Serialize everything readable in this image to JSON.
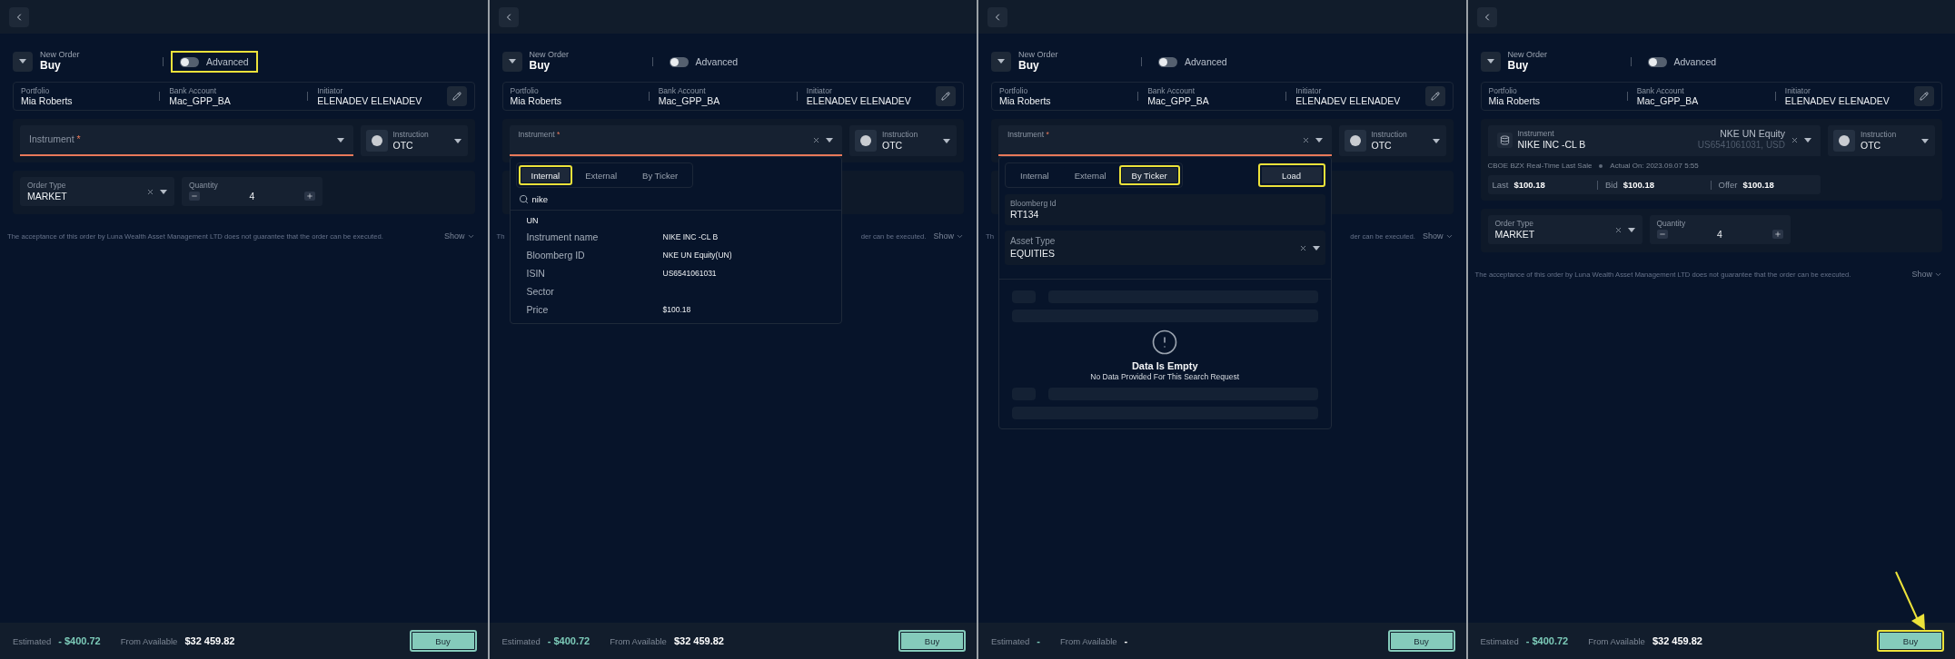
{
  "panels": [
    {
      "header": {
        "caption": "New Order",
        "side": "Buy",
        "advanced": {
          "label": "Advanced",
          "on": false,
          "highlighted": true
        }
      },
      "info": [
        {
          "label": "Portfolio",
          "value": "Mia Roberts"
        },
        {
          "label": "Bank Account",
          "value": "Mac_GPP_BA"
        },
        {
          "label": "Initiator",
          "value": "ELENADEV ELENADEV"
        }
      ],
      "instrument": {
        "kind": "empty",
        "label": "Instrument",
        "required_mark": "*",
        "error": true
      },
      "instruction": {
        "label": "Instruction",
        "value": "OTC"
      },
      "order": {
        "order_type": {
          "label": "Order Type",
          "value": "MARKET"
        },
        "quantity": {
          "label": "Quantity",
          "value": "4"
        }
      },
      "disclaimer": {
        "parts": [
          "The acceptance of this order by Luna Wealth Asset Management LTD does not guarantee that the order can be executed."
        ]
      },
      "show_toggle": "Show",
      "footer": {
        "estimated_label": "Estimated",
        "estimated_value": "- $400.72",
        "available_label": "From Available",
        "available_value": "$32 459.82",
        "buy_button": {
          "label": "Buy",
          "highlighted": false,
          "pointed": false
        }
      }
    },
    {
      "header": {
        "caption": "New Order",
        "side": "Buy",
        "advanced": {
          "label": "Advanced",
          "on": false,
          "highlighted": false
        }
      },
      "info": [
        {
          "label": "Portfolio",
          "value": "Mia Roberts"
        },
        {
          "label": "Bank Account",
          "value": "Mac_GPP_BA"
        },
        {
          "label": "Initiator",
          "value": "ELENADEV ELENADEV"
        }
      ],
      "instrument": {
        "kind": "focused",
        "label": "Instrument",
        "required_mark": "*",
        "error": true
      },
      "instruction": {
        "label": "Instruction",
        "value": "OTC"
      },
      "dropdown": {
        "kind": "search",
        "tabs": [
          {
            "label": "Internal",
            "selected": true,
            "highlighted": true
          },
          {
            "label": "External",
            "selected": false,
            "highlighted": false
          },
          {
            "label": "By Ticker",
            "selected": false,
            "highlighted": false
          }
        ],
        "search_value": "nike",
        "group": "UN",
        "rows": [
          {
            "label": "Instrument name",
            "value": "NIKE INC -CL B"
          },
          {
            "label": "Bloomberg ID",
            "value": "NKE UN Equity(UN)"
          },
          {
            "label": "ISIN",
            "value": "US6541061031"
          },
          {
            "label": "Sector"
          },
          {
            "label": "Price",
            "value": "$100.18"
          }
        ]
      },
      "disclaimer": {
        "parts": [
          "Th",
          "der can be executed."
        ]
      },
      "show_toggle": "Show",
      "footer": {
        "estimated_label": "Estimated",
        "estimated_value": "- $400.72",
        "available_label": "From Available",
        "available_value": "$32 459.82",
        "buy_button": {
          "label": "Buy",
          "highlighted": false,
          "pointed": false
        }
      }
    },
    {
      "header": {
        "caption": "New Order",
        "side": "Buy",
        "advanced": {
          "label": "Advanced",
          "on": false,
          "highlighted": false
        }
      },
      "info": [
        {
          "label": "Portfolio",
          "value": "Mia Roberts"
        },
        {
          "label": "Bank Account",
          "value": "Mac_GPP_BA"
        },
        {
          "label": "Initiator",
          "value": "ELENADEV ELENADEV"
        }
      ],
      "instrument": {
        "kind": "focused",
        "label": "Instrument",
        "required_mark": "*",
        "error": true
      },
      "instruction": {
        "label": "Instruction",
        "value": "OTC"
      },
      "dropdown": {
        "kind": "ticker",
        "tabs": [
          {
            "label": "Internal",
            "selected": false,
            "highlighted": false
          },
          {
            "label": "External",
            "selected": false,
            "highlighted": false
          },
          {
            "label": "By Ticker",
            "selected": true,
            "highlighted": true
          }
        ],
        "load_button": {
          "label": "Load",
          "highlighted": true
        },
        "fields": [
          {
            "label": "Bloomberg Id",
            "value": "RT134",
            "kind": "text"
          },
          {
            "label": "Asset Type",
            "value": "EQUITIES",
            "kind": "select"
          }
        ],
        "empty_title": "Data Is Empty",
        "empty_message": "No Data Provided For This Search Request"
      },
      "disclaimer": {
        "parts": [
          "Th",
          "der can be executed."
        ]
      },
      "show_toggle": "Show",
      "footer": {
        "estimated_label": "Estimated",
        "estimated_value": "-",
        "available_label": "From Available",
        "available_value": "-",
        "buy_button": {
          "label": "Buy",
          "highlighted": false,
          "pointed": false
        }
      }
    },
    {
      "header": {
        "caption": "New Order",
        "side": "Buy",
        "advanced": {
          "label": "Advanced",
          "on": false,
          "highlighted": false
        }
      },
      "info": [
        {
          "label": "Portfolio",
          "value": "Mia Roberts"
        },
        {
          "label": "Bank Account",
          "value": "Mac_GPP_BA"
        },
        {
          "label": "Initiator",
          "value": "ELENADEV ELENADEV"
        }
      ],
      "instrument": {
        "kind": "filled",
        "label": "Instrument",
        "value": "NIKE INC -CL B",
        "ticker": "NKE UN Equity",
        "details": "US6541061031, USD",
        "error": false
      },
      "instruction": {
        "label": "Instruction",
        "value": "OTC"
      },
      "quote": {
        "source": "CBOE BZX Real-Time Last Sale",
        "actual": "Actual On: 2023.09.07 5:55",
        "items": [
          {
            "label": "Last",
            "value": "$100.18"
          },
          {
            "label": "Bid",
            "value": "$100.18"
          },
          {
            "label": "Offer",
            "value": "$100.18"
          }
        ]
      },
      "order": {
        "order_type": {
          "label": "Order Type",
          "value": "MARKET"
        },
        "quantity": {
          "label": "Quantity",
          "value": "4"
        }
      },
      "disclaimer": {
        "parts": [
          "The acceptance of this order by Luna Wealth Asset Management LTD does not guarantee that the order can be executed."
        ]
      },
      "show_toggle": "Show",
      "footer": {
        "estimated_label": "Estimated",
        "estimated_value": "- $400.72",
        "available_label": "From Available",
        "available_value": "$32 459.82",
        "buy_button": {
          "label": "Buy",
          "highlighted": true,
          "pointed": true
        }
      }
    }
  ]
}
